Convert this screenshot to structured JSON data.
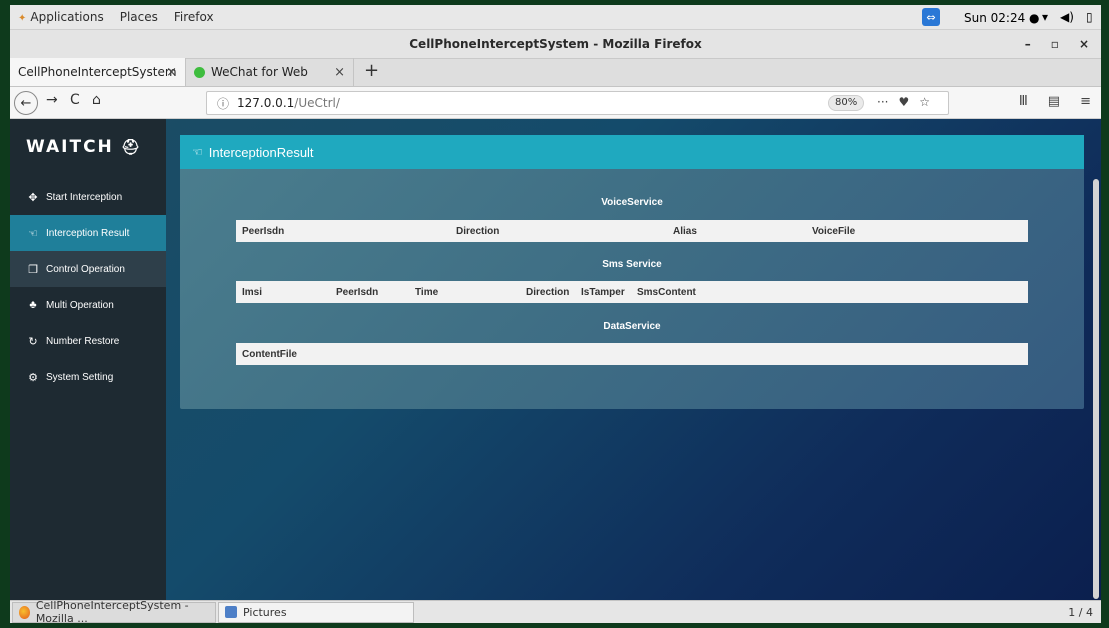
{
  "system": {
    "menus": [
      "Applications",
      "Places",
      "Firefox"
    ],
    "clock": "Sun 02:24 ●",
    "teamviewer_icon": "teamviewer-icon"
  },
  "window": {
    "title": "CellPhoneInterceptSystem - Mozilla Firefox",
    "controls": [
      "–",
      "▫",
      "×"
    ]
  },
  "tabs": [
    {
      "label": "CellPhoneInterceptSystem",
      "close": "×"
    },
    {
      "label": "WeChat for Web",
      "close": "×"
    }
  ],
  "new_tab": "+",
  "navbar": {
    "url_host": "127.0.0.1",
    "url_path": "/UeCtrl/",
    "zoom": "80%",
    "more": "···",
    "back": "←",
    "forward": "→",
    "reload": "C",
    "home": "⌂"
  },
  "app": {
    "logo": "WAITCH",
    "sidebar": [
      {
        "label": "Start Interception",
        "icon": "crosshair-icon",
        "glyph": "✥"
      },
      {
        "label": "Interception Result",
        "icon": "intercept-icon",
        "glyph": "☜"
      },
      {
        "label": "Control Operation",
        "icon": "copy-icon",
        "glyph": "❐"
      },
      {
        "label": "Multi Operation",
        "icon": "sitemap-icon",
        "glyph": "♣"
      },
      {
        "label": "Number Restore",
        "icon": "refresh-icon",
        "glyph": "↻"
      },
      {
        "label": "System Setting",
        "icon": "gears-icon",
        "glyph": "⚙"
      }
    ],
    "panel": {
      "title": "InterceptionResult",
      "voice": {
        "title": "VoiceService",
        "columns": [
          "PeerIsdn",
          "Direction",
          "Alias",
          "VoiceFile"
        ]
      },
      "sms": {
        "title": "Sms Service",
        "columns": [
          "Imsi",
          "PeerIsdn",
          "Time",
          "Direction",
          "IsTamper",
          "SmsContent"
        ]
      },
      "data": {
        "title": "DataService",
        "columns": [
          "ContentFile"
        ]
      }
    }
  },
  "taskbar": {
    "items": [
      "CellPhoneInterceptSystem - Mozilla ...",
      "Pictures"
    ],
    "workspace": "1 / 4"
  }
}
